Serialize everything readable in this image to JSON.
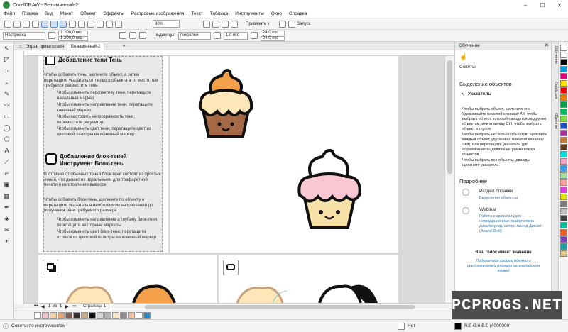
{
  "window": {
    "title": "CorelDRAW - Безымянный-2",
    "min": "–",
    "max": "☐",
    "close": "✕"
  },
  "menu": [
    "Файл",
    "Правка",
    "Вид",
    "Макет",
    "Объект",
    "Эффекты",
    "Растровые изображения",
    "Текст",
    "Таблица",
    "Инструменты",
    "Окно",
    "Справка"
  ],
  "toolbar1": {
    "zoom": "90%",
    "snap": "Привязать к",
    "launch": "Запуск"
  },
  "toolbar2": {
    "preset": "Настройка",
    "width": "1 200,0 пкс",
    "height": "1 200,0 пкс",
    "units_label": "Единицы:",
    "units": "пикселей",
    "nudge": "1,0 пкс",
    "dup_x": "24,0 пкс",
    "dup_y": "24,0 пкс"
  },
  "tabs": {
    "welcome": "Экран приветствия",
    "doc": "Безымянный-2",
    "add": "+"
  },
  "page_text": {
    "shadow_heading": "Добавление тени Тень",
    "shadow_body": "Чтобы добавить тень, щелкните объект, а затем перетащите указатель от первого объекта в то место, где требуется разместить тень.",
    "shadow_bullets": [
      "Чтобы изменить перспективу тени, перетащите начальный маркер",
      "Чтобы изменить направление тени, перетащите конечный маркер",
      "Чтобы настроить непрозрачность тени, переместите регулятор.",
      "Чтобы изменить цвет тени, перетащите цвет из цветовой палитры на конечный маркер"
    ],
    "block_heading": "Добавление блок-теней Инструмент Блок-тень",
    "block_body1": "В отличие от обычных теней блок-тени состоят из простых линий, что делает их идеальными для трафаретной печати и изготовления вывесок",
    "block_body2": "Чтобы добавить блок-тень, щелкните по объекту и перетащите указатель в необходимом направлении до получения тени требуемого размера",
    "block_bullets": [
      "Чтобы изменить направление и глубину блок-тени, перетащите векторные маркеры",
      "Чтобы изменить цвет блок-тени, перетащите оттенок из цветовой палитры на конечный маркер"
    ]
  },
  "docker": {
    "title": "Обучение",
    "tips": "Советы",
    "section": "Выделение объектов",
    "tool": "Указатель",
    "p1": "Чтобы выбрать объект, щелкните его. Удерживайте нажатой клавишу Alt, чтобы выбрать объект, который находится за другим объектом, или клавишу Ctrl, чтобы выбрать объект в группе.",
    "p2": "Чтобы выбрать несколько объектов, щелкните каждый объект, удерживая нажатой клавишу Shift, или перетащите указатель для образования выделяющей рамки вокруг объектов.",
    "p3": "Чтобы выбрать все объекты, дважды щелкните указатель.",
    "more": "Подробнее",
    "link1_title": "Раздел справки",
    "link1_sub": "Выделение объектов",
    "link2_title": "Webinar",
    "link2_sub": "Работа с кривыми (для нетрадиционных графических дизайнеров), автор: Ананд Диксит (Anand Dixit)",
    "feedback_title": "Ваш голос имеет значение",
    "feedback_sub": "Поделитесь своими идеями и предложениями (только на английском языке)"
  },
  "side_tabs": [
    "Обучение",
    "Свойства",
    "Объекты"
  ],
  "page_nav": {
    "pos": "1",
    "of": "из",
    "total": "1",
    "page": "Страница 1"
  },
  "status": {
    "hint": "Советы по инструментам",
    "fill": "Нет",
    "color": "R:0 G:0 B:0 (#000000)"
  },
  "watermark": "PCPROGS.NET",
  "colors": {
    "orange": "#f4a04a",
    "brown": "#a46a48",
    "cream": "#fde6b8",
    "pink": "#f9c6d3",
    "beige": "#f7e1a6"
  }
}
